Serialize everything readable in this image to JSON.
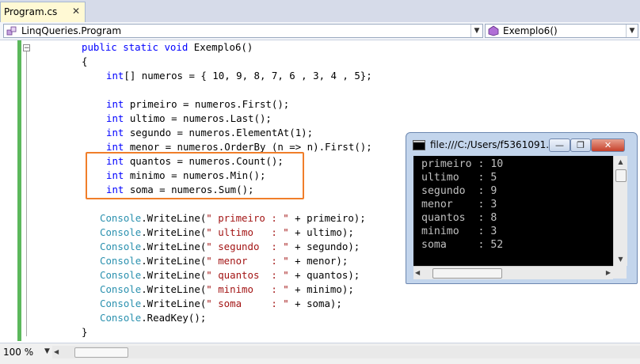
{
  "tab": {
    "label": "Program.cs",
    "close": "✕"
  },
  "nav": {
    "class_combo": "LinqQueries.Program",
    "member_combo": "Exemplo6()"
  },
  "outline_toggle": "−",
  "code_lines": [
    [
      [
        "kw",
        "public "
      ],
      [
        "kw",
        "static "
      ],
      [
        "kw",
        "void "
      ],
      [
        "",
        "Exemplo6()"
      ]
    ],
    [
      [
        "",
        "{"
      ]
    ],
    [
      [
        "kw",
        "int"
      ],
      [
        "",
        "[] numeros = { 10, 9, 8, 7, 6 , 3, 4 , 5};"
      ]
    ],
    [
      [
        "",
        ""
      ]
    ],
    [
      [
        "kw",
        "int"
      ],
      [
        "",
        " primeiro = numeros.First();"
      ]
    ],
    [
      [
        "kw",
        "int"
      ],
      [
        "",
        " ultimo = numeros.Last();"
      ]
    ],
    [
      [
        "kw",
        "int"
      ],
      [
        "",
        " segundo = numeros.ElementAt(1);"
      ]
    ],
    [
      [
        "kw",
        "int"
      ],
      [
        "",
        " menor = numeros.OrderBy (n => n).First();"
      ]
    ],
    [
      [
        "kw",
        "int"
      ],
      [
        "",
        " quantos = numeros.Count();"
      ]
    ],
    [
      [
        "kw",
        "int"
      ],
      [
        "",
        " minimo = numeros.Min();"
      ]
    ],
    [
      [
        "kw",
        "int"
      ],
      [
        "",
        " soma = numeros.Sum();"
      ]
    ],
    [
      [
        "",
        ""
      ]
    ],
    [
      [
        "ty",
        "Console"
      ],
      [
        "",
        ".WriteLine("
      ],
      [
        "st",
        "\" primeiro : \""
      ],
      [
        "",
        " + primeiro);"
      ]
    ],
    [
      [
        "ty",
        "Console"
      ],
      [
        "",
        ".WriteLine("
      ],
      [
        "st",
        "\" ultimo   : \""
      ],
      [
        "",
        " + ultimo);"
      ]
    ],
    [
      [
        "ty",
        "Console"
      ],
      [
        "",
        ".WriteLine("
      ],
      [
        "st",
        "\" segundo  : \""
      ],
      [
        "",
        " + segundo);"
      ]
    ],
    [
      [
        "ty",
        "Console"
      ],
      [
        "",
        ".WriteLine("
      ],
      [
        "st",
        "\" menor    : \""
      ],
      [
        "",
        " + menor);"
      ]
    ],
    [
      [
        "ty",
        "Console"
      ],
      [
        "",
        ".WriteLine("
      ],
      [
        "st",
        "\" quantos  : \""
      ],
      [
        "",
        " + quantos);"
      ]
    ],
    [
      [
        "ty",
        "Console"
      ],
      [
        "",
        ".WriteLine("
      ],
      [
        "st",
        "\" minimo   : \""
      ],
      [
        "",
        " + minimo);"
      ]
    ],
    [
      [
        "ty",
        "Console"
      ],
      [
        "",
        ".WriteLine("
      ],
      [
        "st",
        "\" soma     : \""
      ],
      [
        "",
        " + soma);"
      ]
    ],
    [
      [
        "ty",
        "Console"
      ],
      [
        "",
        ".ReadKey();"
      ]
    ],
    [
      [
        "",
        "}"
      ]
    ]
  ],
  "console": {
    "title": "file:///C:/Users/f5361091...",
    "minimize": "—",
    "maximize": "❐",
    "close": "✕",
    "output": [
      "primeiro : 10",
      "ultimo   : 5",
      "segundo  : 9",
      "menor    : 3",
      "quantos  : 8",
      "minimo   : 3",
      "soma     : 52"
    ]
  },
  "status": {
    "zoom": "100 %"
  },
  "colors": {
    "keyword": "#0000ff",
    "type": "#2b91af",
    "string": "#a31515",
    "highlight_box": "#f07e2a",
    "change_bar": "#5cb85c"
  }
}
